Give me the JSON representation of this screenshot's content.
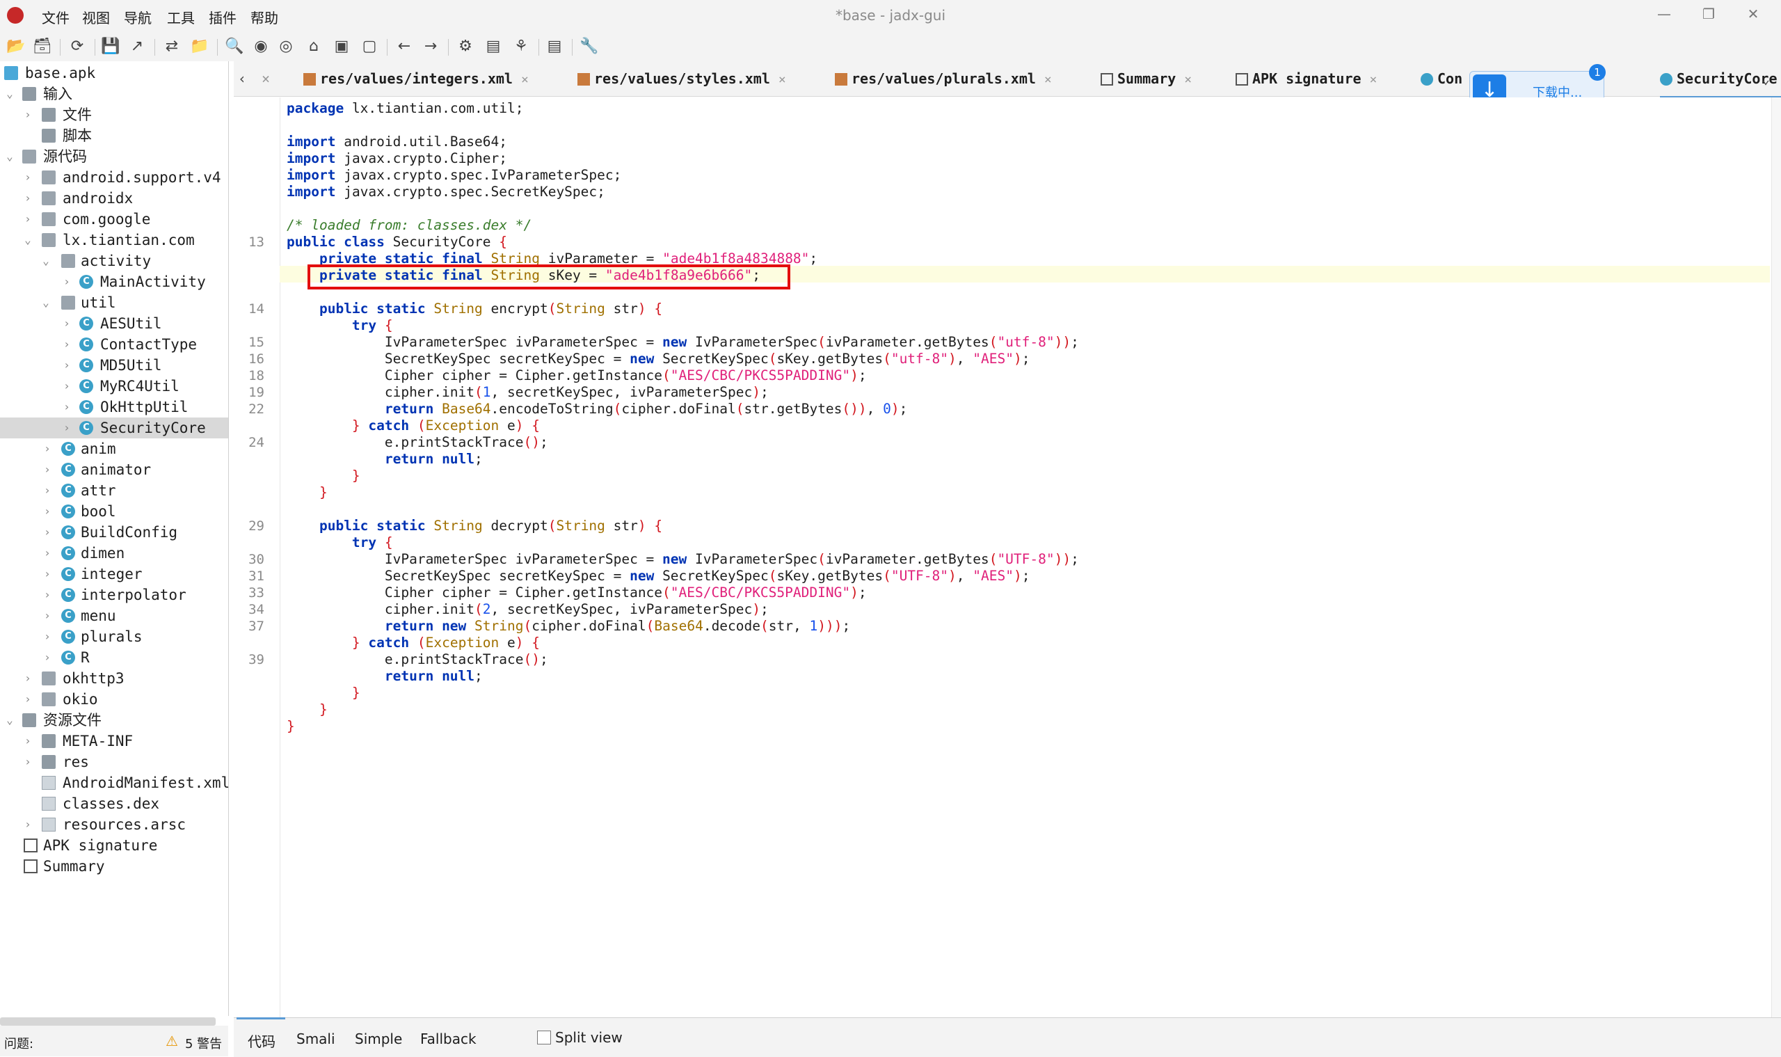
{
  "window": {
    "title": "*base - jadx-gui",
    "menu": [
      "文件",
      "视图",
      "导航",
      "工具",
      "插件",
      "帮助"
    ]
  },
  "toolbar": {
    "icons": [
      "open-icon",
      "add-files-icon",
      "reload-icon",
      "save-icon",
      "export-icon",
      "sync-icon",
      "flatten-icon",
      "search-icon",
      "find-class-icon",
      "find-usage-icon",
      "home-icon",
      "decompile-icon",
      "kotlin-icon",
      "back-icon",
      "forward-icon",
      "quark-icon",
      "deobfuscation-icon",
      "debug-icon",
      "log-icon",
      "preferences-icon"
    ]
  },
  "tree": {
    "items": [
      {
        "label": "base.apk",
        "icon": "apk-icon"
      },
      {
        "label": "输入",
        "icon": "folder-icon"
      },
      {
        "label": "文件",
        "icon": "folder-icon"
      },
      {
        "label": "脚本",
        "icon": "folder-icon"
      },
      {
        "label": "源代码",
        "icon": "package-icon"
      },
      {
        "label": "android.support.v4",
        "icon": "package-icon"
      },
      {
        "label": "androidx",
        "icon": "package-icon"
      },
      {
        "label": "com.google",
        "icon": "package-icon"
      },
      {
        "label": "lx.tiantian.com",
        "icon": "package-icon"
      },
      {
        "label": "activity",
        "icon": "package-icon"
      },
      {
        "label": "MainActivity",
        "icon": "class-icon"
      },
      {
        "label": "util",
        "icon": "package-icon"
      },
      {
        "label": "AESUtil",
        "icon": "class-icon"
      },
      {
        "label": "ContactType",
        "icon": "class-icon"
      },
      {
        "label": "MD5Util",
        "icon": "class-icon"
      },
      {
        "label": "MyRC4Util",
        "icon": "class-icon"
      },
      {
        "label": "OkHttpUtil",
        "icon": "class-icon"
      },
      {
        "label": "SecurityCore",
        "icon": "class-icon"
      },
      {
        "label": "anim",
        "icon": "class-icon"
      },
      {
        "label": "animator",
        "icon": "class-icon"
      },
      {
        "label": "attr",
        "icon": "class-icon"
      },
      {
        "label": "bool",
        "icon": "class-icon"
      },
      {
        "label": "BuildConfig",
        "icon": "class-icon"
      },
      {
        "label": "dimen",
        "icon": "class-icon"
      },
      {
        "label": "integer",
        "icon": "class-icon"
      },
      {
        "label": "interpolator",
        "icon": "class-icon"
      },
      {
        "label": "menu",
        "icon": "class-icon"
      },
      {
        "label": "plurals",
        "icon": "class-icon"
      },
      {
        "label": "R",
        "icon": "class-icon"
      },
      {
        "label": "okhttp3",
        "icon": "package-icon"
      },
      {
        "label": "okio",
        "icon": "package-icon"
      },
      {
        "label": "资源文件",
        "icon": "folder-icon"
      },
      {
        "label": "META-INF",
        "icon": "folder-icon"
      },
      {
        "label": "res",
        "icon": "folder-icon"
      },
      {
        "label": "AndroidManifest.xml",
        "icon": "manifest-icon"
      },
      {
        "label": "classes.dex",
        "icon": "file-icon"
      },
      {
        "label": "resources.arsc",
        "icon": "file-icon"
      },
      {
        "label": "APK signature",
        "icon": "signature-icon"
      },
      {
        "label": "Summary",
        "icon": "summary-icon"
      }
    ]
  },
  "tabs": [
    {
      "label": "res/values/integers.xml"
    },
    {
      "label": "res/values/styles.xml"
    },
    {
      "label": "res/values/plurals.xml"
    },
    {
      "label": "Summary"
    },
    {
      "label": "APK signature"
    },
    {
      "label": "Con"
    },
    {
      "label": "SecurityCore"
    }
  ],
  "download": {
    "text": "下载中...",
    "badge": "1"
  },
  "code": {
    "line_numbers": [
      "13",
      "14",
      "15",
      "16",
      "18",
      "19",
      "22",
      "24",
      "29",
      "30",
      "31",
      "33",
      "34",
      "37",
      "39"
    ],
    "package": "lx.tiantian.com.util",
    "imports": [
      "android.util.Base64",
      "javax.crypto.Cipher",
      "javax.crypto.spec.IvParameterSpec",
      "javax.crypto.spec.SecretKeySpec"
    ],
    "comment": "/* loaded from: classes.dex */",
    "class_name": "SecurityCore",
    "iv_value": "\"ade4b1f8a4834888\"",
    "skey_value": "\"ade4b1f8a9e6b666\"",
    "charset_lower": "\"utf-8\"",
    "charset_upper": "\"UTF-8\"",
    "aes": "\"AES\"",
    "transformation": "\"AES/CBC/PKCS5PADDING\""
  },
  "bottom": {
    "tabs": [
      "代码",
      "Smali",
      "Simple",
      "Fallback"
    ],
    "split_view": "Split view",
    "problems_label": "问题:",
    "warnings": "5 警告"
  },
  "colors": {
    "accent": "#5a9bd5",
    "highlight_box": "#e30e0e",
    "line_highlight": "#fdfde0"
  }
}
